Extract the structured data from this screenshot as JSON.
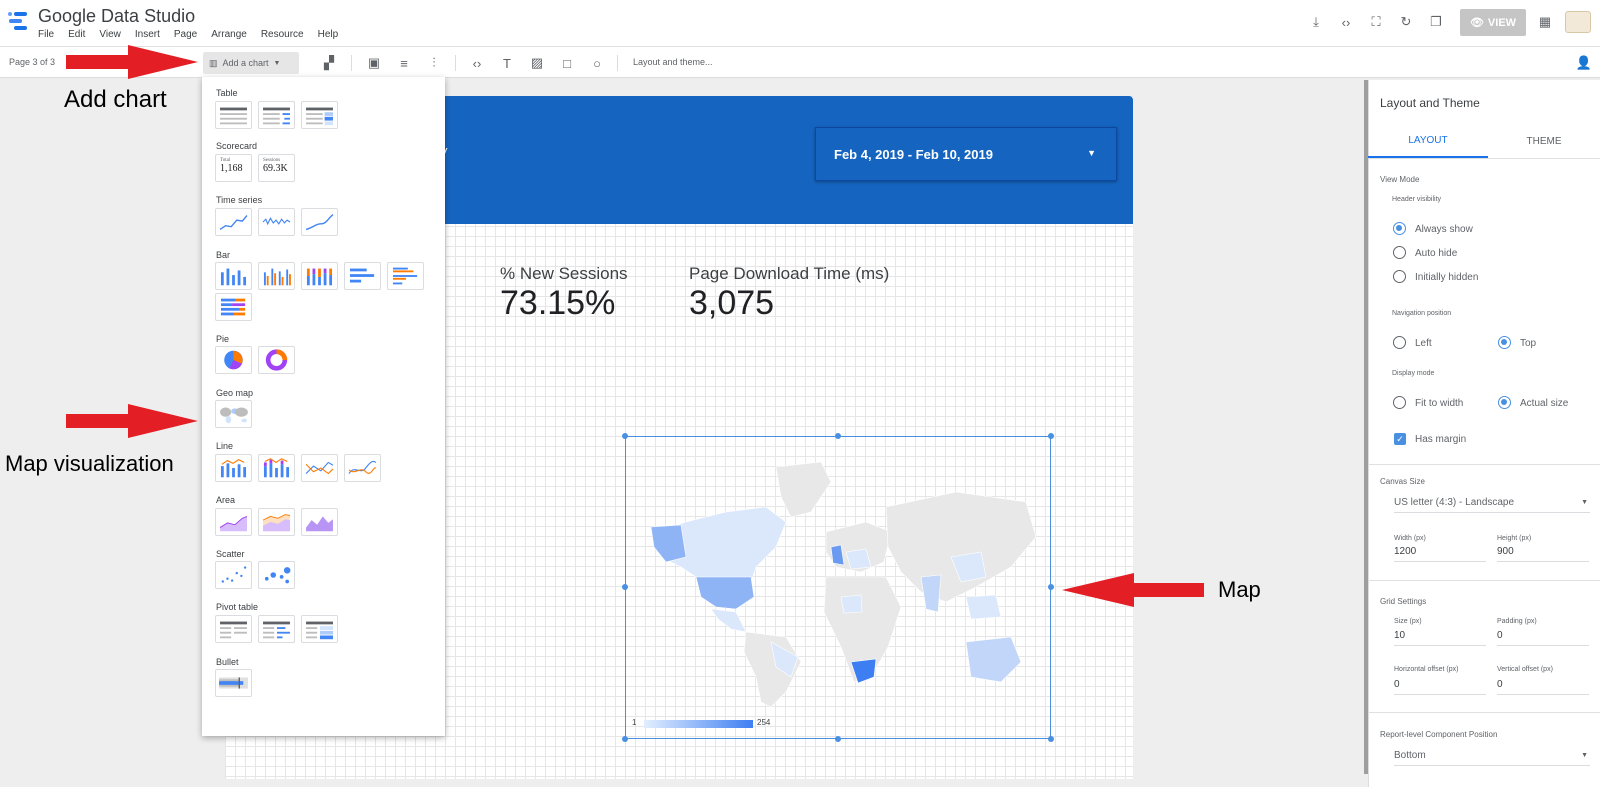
{
  "app": {
    "title": "Google Data Studio"
  },
  "menu": [
    "File",
    "Edit",
    "View",
    "Insert",
    "Page",
    "Arrange",
    "Resource",
    "Help"
  ],
  "top_actions": {
    "view_label": "VIEW"
  },
  "toolbar": {
    "page_indicator": "Page 3 of 3",
    "add_chart_label": "Add a chart",
    "layout_theme_label": "Layout and theme..."
  },
  "report": {
    "date_range": "Feb 4, 2019 - Feb 10, 2019",
    "scorecards": [
      {
        "label": "% New Sessions",
        "value": "73.15%"
      },
      {
        "label": "Page Download Time (ms)",
        "value": "3,075"
      }
    ],
    "map_legend": {
      "min": "1",
      "max": "254"
    }
  },
  "chart_menu": {
    "table": "Table",
    "scorecard": "Scorecard",
    "scorecard_samples": [
      {
        "label": "Total",
        "value": "1,168"
      },
      {
        "label": "Sessions",
        "value": "69.3K"
      }
    ],
    "time_series": "Time series",
    "bar": "Bar",
    "pie": "Pie",
    "geo_map": "Geo map",
    "line": "Line",
    "area": "Area",
    "scatter": "Scatter",
    "pivot_table": "Pivot table",
    "bullet": "Bullet"
  },
  "annotations": {
    "add_chart": "Add chart",
    "map_visualization": "Map visualization",
    "map": "Map"
  },
  "right_panel": {
    "title": "Layout and Theme",
    "tabs": [
      "LAYOUT",
      "THEME"
    ],
    "view_mode": "View Mode",
    "header_visibility": "Header visibility",
    "header_options": [
      "Always show",
      "Auto hide",
      "Initially hidden"
    ],
    "navigation_position": "Navigation position",
    "nav_options": [
      "Left",
      "Top"
    ],
    "display_mode": "Display mode",
    "display_options": [
      "Fit to width",
      "Actual size"
    ],
    "has_margin": "Has margin",
    "canvas_size": "Canvas Size",
    "canvas_size_value": "US letter (4:3) - Landscape",
    "width_label": "Width (px)",
    "width_value": "1200",
    "height_label": "Height (px)",
    "height_value": "900",
    "grid_settings": "Grid Settings",
    "size_label": "Size (px)",
    "size_value": "10",
    "padding_label": "Padding (px)",
    "padding_value": "0",
    "hoffset_label": "Horizontal offset (px)",
    "hoffset_value": "0",
    "voffset_label": "Vertical offset (px)",
    "voffset_value": "0",
    "component_position": "Report-level Component Position",
    "component_position_value": "Bottom"
  },
  "colors": {
    "header_blue": "#1565c0",
    "accent": "#4a90e2",
    "arrow_red": "#e31e24"
  }
}
